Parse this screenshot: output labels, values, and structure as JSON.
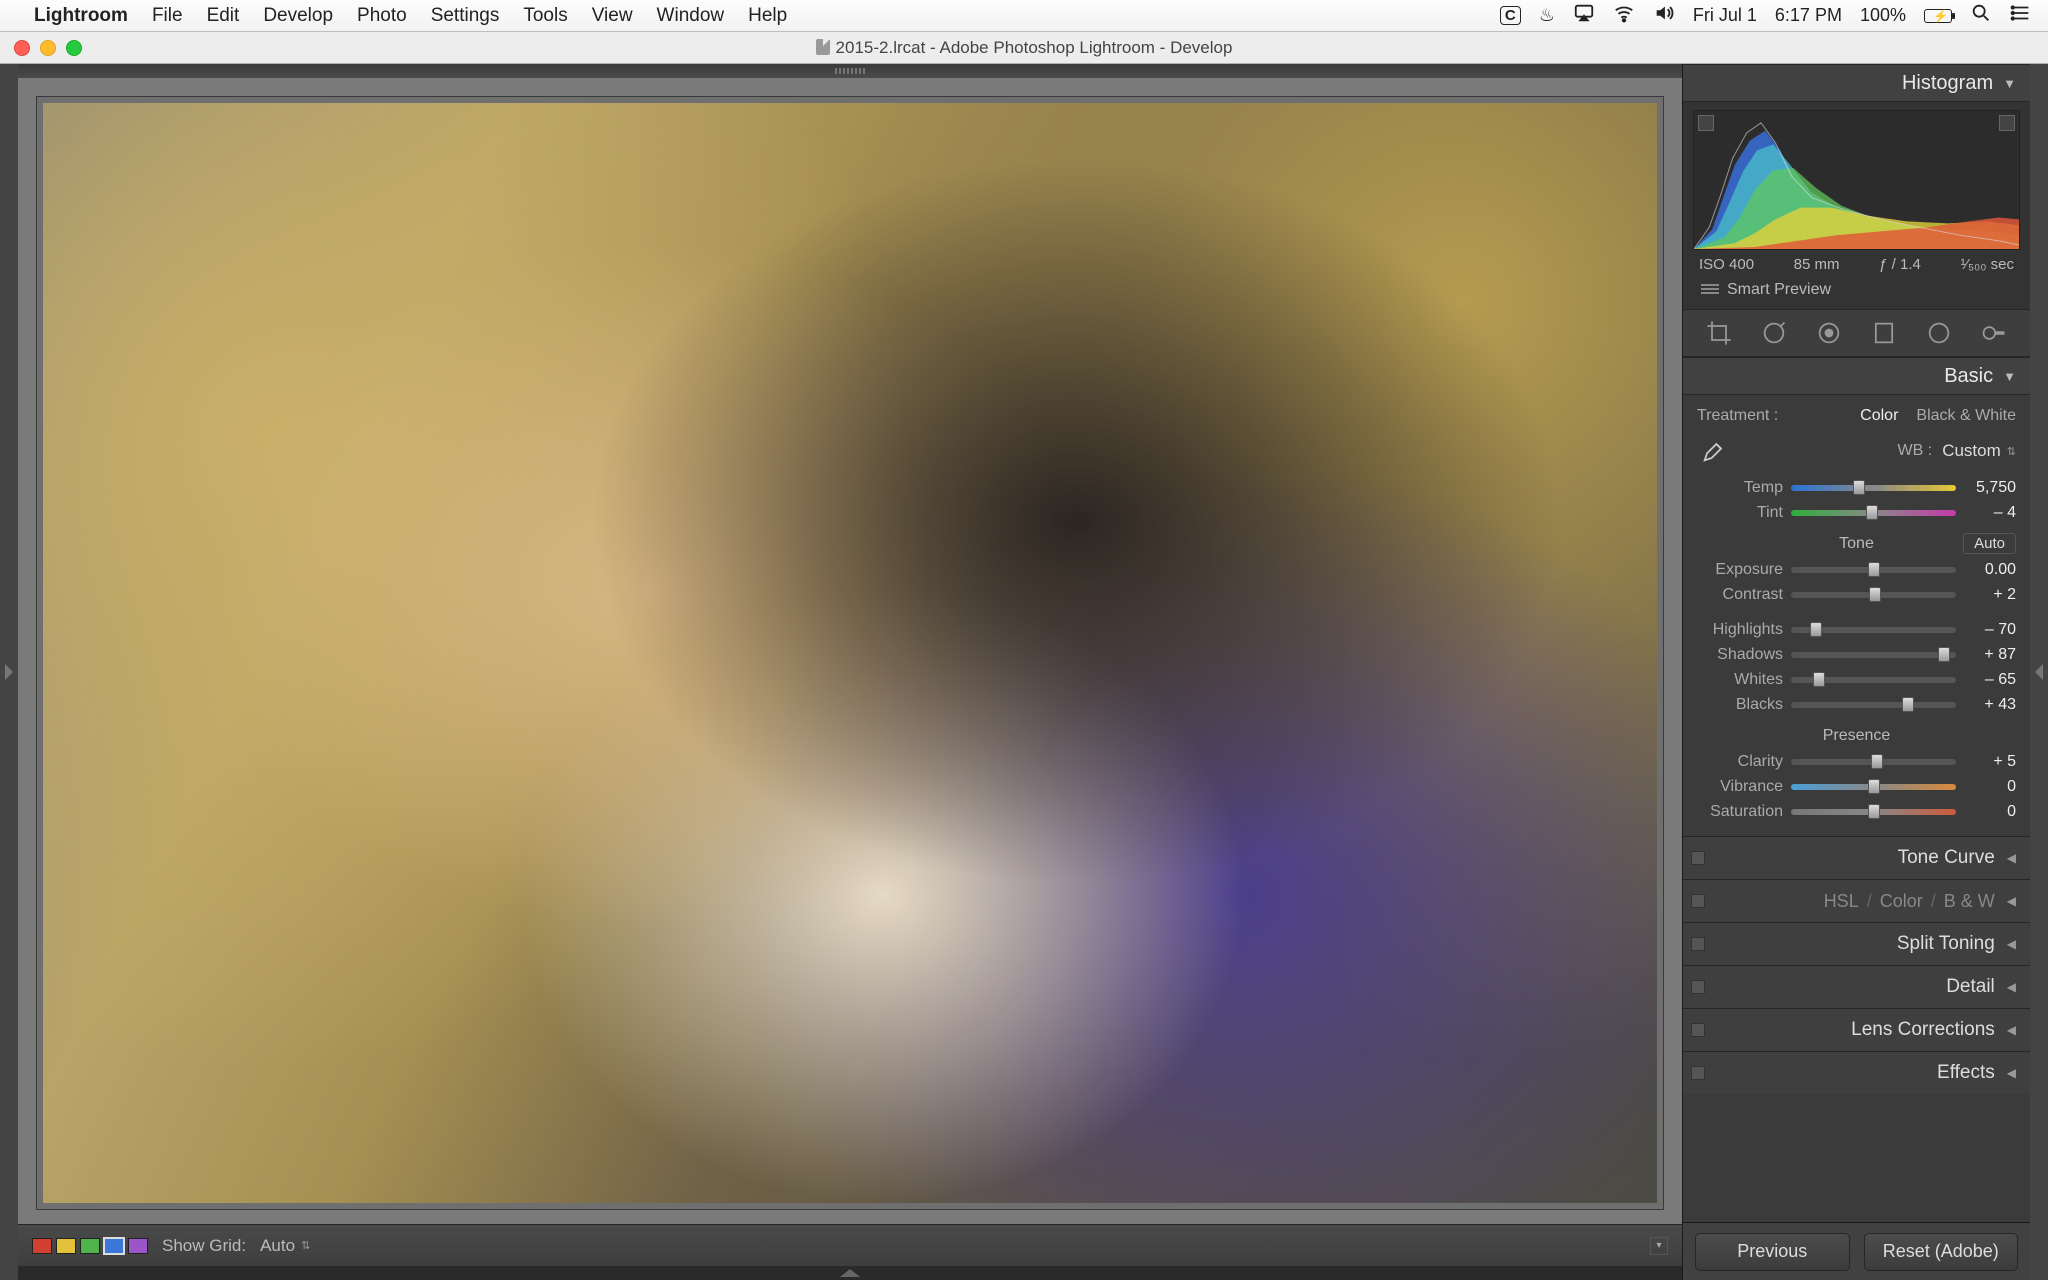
{
  "menubar": {
    "app": "Lightroom",
    "items": [
      "File",
      "Edit",
      "Develop",
      "Photo",
      "Settings",
      "Tools",
      "View",
      "Window",
      "Help"
    ],
    "right": {
      "date": "Fri Jul 1",
      "time": "6:17 PM",
      "battery": "100%"
    }
  },
  "window": {
    "title": "2015-2.lrcat - Adobe Photoshop Lightroom - Develop"
  },
  "toolbar": {
    "swatches": [
      "#d24034",
      "#e3c23b",
      "#4fb24a",
      "#3b77d8",
      "#9b55c9"
    ],
    "selected_swatch": 3,
    "show_grid_label": "Show Grid:",
    "show_grid_value": "Auto"
  },
  "panel": {
    "histogram": {
      "title": "Histogram",
      "iso": "ISO 400",
      "focal": "85 mm",
      "aperture": "ƒ / 1.4",
      "shutter": "¹⁄₅₀₀ sec",
      "smart_preview": "Smart Preview"
    },
    "basic": {
      "title": "Basic",
      "treatment_label": "Treatment :",
      "treatment_color": "Color",
      "treatment_bw": "Black & White",
      "wb_label": "WB :",
      "wb_value": "Custom",
      "tone_label": "Tone",
      "auto_label": "Auto",
      "presence_label": "Presence",
      "sliders": {
        "temp": {
          "label": "Temp",
          "value": "5,750",
          "pos": 41
        },
        "tint": {
          "label": "Tint",
          "value": "– 4",
          "pos": 49
        },
        "exposure": {
          "label": "Exposure",
          "value": "0.00",
          "pos": 50
        },
        "contrast": {
          "label": "Contrast",
          "value": "+ 2",
          "pos": 51
        },
        "highlights": {
          "label": "Highlights",
          "value": "– 70",
          "pos": 15
        },
        "shadows": {
          "label": "Shadows",
          "value": "+ 87",
          "pos": 93
        },
        "whites": {
          "label": "Whites",
          "value": "– 65",
          "pos": 17
        },
        "blacks": {
          "label": "Blacks",
          "value": "+ 43",
          "pos": 71
        },
        "clarity": {
          "label": "Clarity",
          "value": "+ 5",
          "pos": 52
        },
        "vibrance": {
          "label": "Vibrance",
          "value": "0",
          "pos": 50
        },
        "saturation": {
          "label": "Saturation",
          "value": "0",
          "pos": 50
        }
      }
    },
    "sections": {
      "tone_curve": "Tone Curve",
      "hsl": "HSL",
      "hsl_color": "Color",
      "hsl_bw": "B & W",
      "split_toning": "Split Toning",
      "detail": "Detail",
      "lens": "Lens Corrections",
      "effects": "Effects"
    },
    "footer": {
      "previous": "Previous",
      "reset": "Reset (Adobe)"
    }
  }
}
